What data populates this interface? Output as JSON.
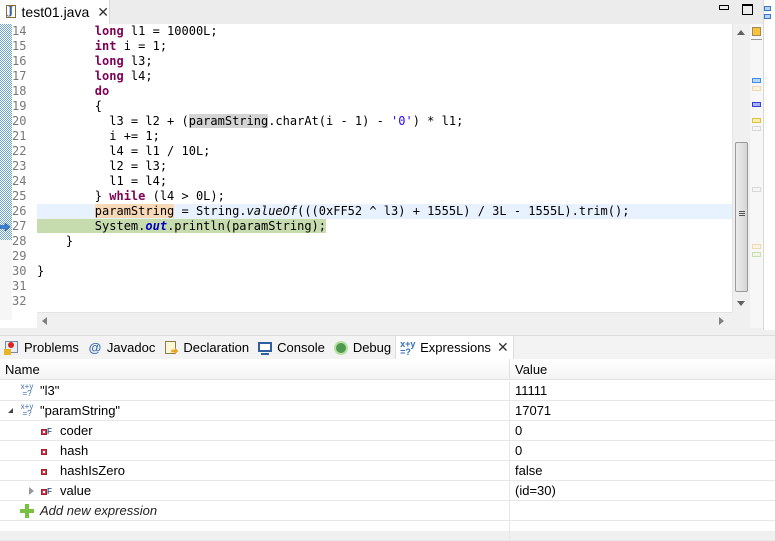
{
  "editor": {
    "tab": {
      "label": "test01.java",
      "icon": "java-file-icon",
      "close": "✕"
    },
    "window_controls": {
      "minimize": "minimize-icon",
      "maximize": "maximize-icon"
    },
    "line_numbers": [
      "14",
      "15",
      "16",
      "17",
      "18",
      "19",
      "20",
      "21",
      "22",
      "23",
      "24",
      "25",
      "26",
      "27",
      "28",
      "29",
      "30",
      "31",
      "32"
    ],
    "current_line": "26",
    "instruction_pointer_line": "27",
    "code": {
      "l14": {
        "indent": "        ",
        "kw": "long",
        "rest": " l1 = 10000L;"
      },
      "l15": {
        "indent": "        ",
        "kw": "int",
        "rest": " i = 1;"
      },
      "l16": {
        "indent": "        ",
        "kw": "long",
        "rest": " l3;"
      },
      "l17": {
        "indent": "        ",
        "kw": "long",
        "rest": " l4;"
      },
      "l18": {
        "indent": "        ",
        "kw": "do",
        "rest": ""
      },
      "l19": {
        "text": "        {"
      },
      "l20": {
        "a": "          l3 = l2 + (",
        "occ": "paramString",
        "b": ".charAt(i - 1) - ",
        "str": "'0'",
        "c": ") * l1;"
      },
      "l21": {
        "text": "          i += 1;"
      },
      "l22": {
        "text": "          l4 = l1 / 10L;"
      },
      "l23": {
        "text": "          l2 = l3;"
      },
      "l24": {
        "text": "          l1 = l4;"
      },
      "l25": {
        "a": "        } ",
        "kw": "while",
        "b": " (l4 > 0L);"
      },
      "l26": {
        "indent": "        ",
        "wocc": "paramString",
        "a": " = String.",
        "it": "valueOf",
        "b": "(((0xFF52 ^ l3) + 1555L) / 3L - 1555L).trim();"
      },
      "l27": {
        "indent": "        ",
        "a": "System.",
        "fld": "out",
        "b": ".println(paramString);"
      },
      "l28": {
        "text": "    }"
      },
      "l29": {
        "text": ""
      },
      "l30": {
        "text": "}"
      },
      "l31": {
        "text": ""
      },
      "l32": {
        "text": ""
      }
    }
  },
  "views": {
    "tabs": [
      {
        "label": "Problems",
        "icon": "problems-icon"
      },
      {
        "label": "Javadoc",
        "icon": "javadoc-icon",
        "glyph": "@"
      },
      {
        "label": "Declaration",
        "icon": "declaration-icon"
      },
      {
        "label": "Console",
        "icon": "console-icon"
      },
      {
        "label": "Debug",
        "icon": "debug-icon"
      },
      {
        "label": "Expressions",
        "icon": "expressions-icon",
        "active": true,
        "close": "✕"
      }
    ]
  },
  "expressions": {
    "columns": {
      "name": "Name",
      "value": "Value"
    },
    "xy_glyph_top": "x+y",
    "xy_glyph_bottom": "=?",
    "field_final_glyph": "F",
    "rows": [
      {
        "name": "\"l3\"",
        "value": "11111",
        "icon": "watch-expression-icon"
      },
      {
        "name": "\"paramString\"",
        "value": "17071",
        "icon": "watch-expression-icon",
        "expanded": true
      },
      {
        "name": "coder",
        "value": "0",
        "icon": "private-final-field-icon"
      },
      {
        "name": "hash",
        "value": "0",
        "icon": "private-field-icon"
      },
      {
        "name": "hashIsZero",
        "value": "false",
        "icon": "private-field-icon"
      },
      {
        "name": "value",
        "value": "(id=30)",
        "icon": "private-final-field-icon",
        "expandable": true
      }
    ],
    "add_new": "Add new expression"
  }
}
